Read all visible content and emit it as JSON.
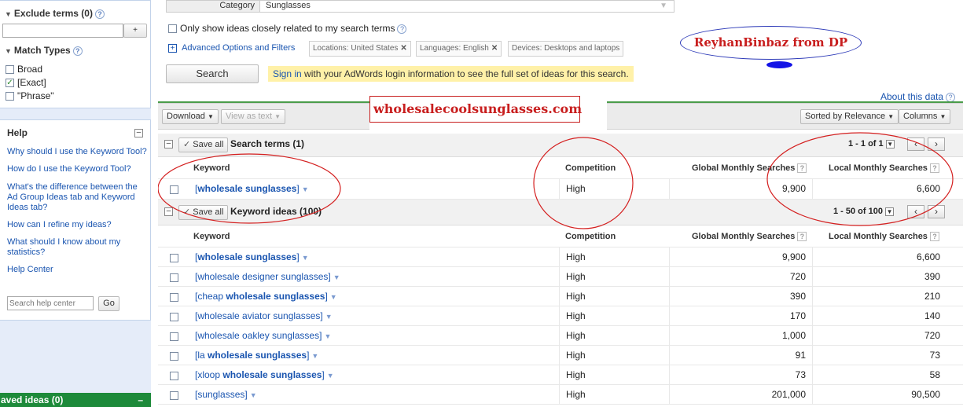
{
  "sidebar": {
    "exclude_terms": {
      "label": "Exclude terms (0)",
      "add_label": "+"
    },
    "match_types": {
      "label": "Match Types",
      "options": [
        {
          "label": "Broad",
          "checked": false
        },
        {
          "label": "[Exact]",
          "checked": true
        },
        {
          "label": "\"Phrase\"",
          "checked": false
        }
      ]
    },
    "help": {
      "title": "Help",
      "links": [
        "Why should I use the Keyword Tool?",
        "How do I use the Keyword Tool?",
        "What's the difference between the Ad Group Ideas tab and Keyword Ideas tab?",
        "How can I refine my ideas?",
        "What should I know about my statistics?"
      ],
      "help_center": "Help Center",
      "search_placeholder": "Search help center",
      "go_label": "Go"
    },
    "saved_ideas": "aved ideas (0)",
    "saved_ideas_toggle": "–"
  },
  "search": {
    "category_label": "Category",
    "category_value": "Sunglasses",
    "closely_related_label": "Only show ideas closely related to my search terms",
    "advanced_label": "Advanced Options and Filters",
    "filters": [
      "Locations: United States",
      "Languages: English",
      "Devices: Desktops and laptops"
    ],
    "search_button": "Search",
    "signin_link": "Sign in",
    "signin_text": " with your AdWords login information to see the full set of ideas for this search."
  },
  "annotations": {
    "watermark": "ReyhanBinbaz from DP",
    "site": "wholesalecoolsunglasses.com"
  },
  "toolbar": {
    "about": "About this data",
    "download": "Download",
    "view_as_text": "View as text",
    "sorted_by": "Sorted by Relevance",
    "columns": "Columns"
  },
  "columns": {
    "keyword": "Keyword",
    "competition": "Competition",
    "global": "Global Monthly Searches",
    "local": "Local Monthly Searches"
  },
  "search_terms": {
    "save_all": "Save all",
    "title": "Search terms (1)",
    "pager": "1 - 1 of 1",
    "rows": [
      {
        "pre": "[",
        "bold": "wholesale sunglasses",
        "post": "]",
        "competition": "High",
        "global": "9,900",
        "local": "6,600"
      }
    ]
  },
  "keyword_ideas": {
    "save_all": "Save all",
    "title": "Keyword ideas (100)",
    "pager": "1 - 50 of 100",
    "rows": [
      {
        "pre": "[",
        "bold": "wholesale sunglasses",
        "post": "]",
        "competition": "High",
        "global": "9,900",
        "local": "6,600"
      },
      {
        "pre": "[wholesale designer sunglasses]",
        "bold": "",
        "post": "",
        "competition": "High",
        "global": "720",
        "local": "390"
      },
      {
        "pre": "[cheap ",
        "bold": "wholesale sunglasses",
        "post": "]",
        "competition": "High",
        "global": "390",
        "local": "210"
      },
      {
        "pre": "[wholesale aviator sunglasses]",
        "bold": "",
        "post": "",
        "competition": "High",
        "global": "170",
        "local": "140"
      },
      {
        "pre": "[wholesale oakley sunglasses]",
        "bold": "",
        "post": "",
        "competition": "High",
        "global": "1,000",
        "local": "720"
      },
      {
        "pre": "[la ",
        "bold": "wholesale sunglasses",
        "post": "]",
        "competition": "High",
        "global": "91",
        "local": "73"
      },
      {
        "pre": "[xloop ",
        "bold": "wholesale sunglasses",
        "post": "]",
        "competition": "High",
        "global": "73",
        "local": "58"
      },
      {
        "pre": "[sunglasses]",
        "bold": "",
        "post": "",
        "competition": "High",
        "global": "201,000",
        "local": "90,500"
      }
    ]
  }
}
